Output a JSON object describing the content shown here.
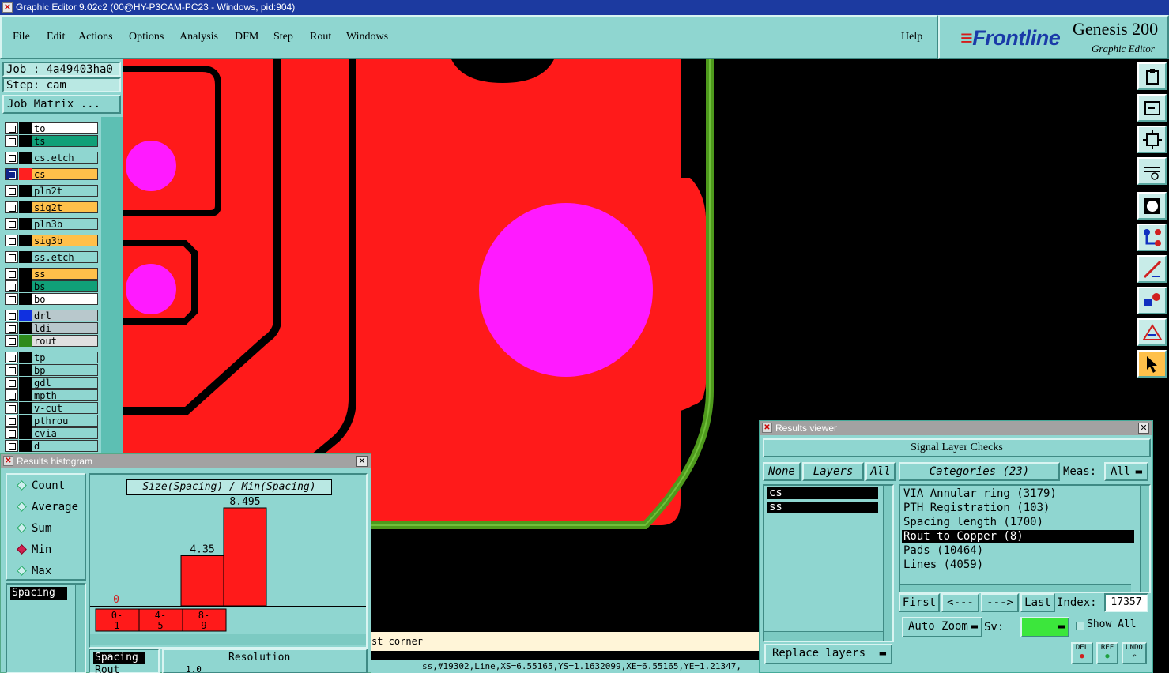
{
  "window": {
    "title": "Graphic Editor 9.02c2 (00@HY-P3CAM-PC23 - Windows, pid:904)"
  },
  "menu": [
    "File",
    "Edit",
    "Actions",
    "Options",
    "Analysis",
    "DFM",
    "Step",
    "Rout",
    "Windows"
  ],
  "help": "Help",
  "brand": {
    "logo": "Frontline",
    "product": "Genesis 200",
    "subtitle": "Graphic Editor"
  },
  "job": {
    "job_label": "Job : 4a49403ha0",
    "step_label": "Step: cam",
    "matrix_button": "Job Matrix ..."
  },
  "colors": {
    "copper": "#ff1a1a",
    "pad": "#ff1aff",
    "rout": "#4e9a1c",
    "ui": "#8fd6d0",
    "orange_layer": "#ffc04a",
    "green_layer": "#10a078"
  },
  "layers": [
    {
      "name": "to",
      "chip": "#000000",
      "bg": "#ffffff"
    },
    {
      "name": "ts",
      "chip": "#000000",
      "bg": "#10a078"
    },
    {
      "name": "cs.etch",
      "chip": "#000000",
      "bg": "#8fd6d0"
    },
    {
      "name": "cs",
      "chip": "#ff2020",
      "bg": "#ffc04a",
      "selected": true
    },
    {
      "name": "pln2t",
      "chip": "#000000",
      "bg": "#8fd6d0"
    },
    {
      "name": "sig2t",
      "chip": "#000000",
      "bg": "#ffc04a"
    },
    {
      "name": "pln3b",
      "chip": "#000000",
      "bg": "#8fd6d0"
    },
    {
      "name": "sig3b",
      "chip": "#000000",
      "bg": "#ffc04a"
    },
    {
      "name": "ss.etch",
      "chip": "#000000",
      "bg": "#8fd6d0"
    },
    {
      "name": "ss",
      "chip": "#000000",
      "bg": "#ffc04a"
    },
    {
      "name": "bs",
      "chip": "#000000",
      "bg": "#10a078"
    },
    {
      "name": "bo",
      "chip": "#000000",
      "bg": "#ffffff"
    },
    {
      "name": "drl",
      "chip": "#1030e0",
      "bg": "#b8c8cc"
    },
    {
      "name": "ldi",
      "chip": "#000000",
      "bg": "#b8c8cc"
    },
    {
      "name": "rout",
      "chip": "#2e8a1c",
      "bg": "#e0e0e0"
    },
    {
      "name": "tp",
      "chip": "#000000",
      "bg": "#8fd6d0"
    },
    {
      "name": "bp",
      "chip": "#000000",
      "bg": "#8fd6d0"
    },
    {
      "name": "gdl",
      "chip": "#000000",
      "bg": "#8fd6d0"
    },
    {
      "name": "mpth",
      "chip": "#000000",
      "bg": "#8fd6d0"
    },
    {
      "name": "v-cut",
      "chip": "#000000",
      "bg": "#8fd6d0"
    },
    {
      "name": "pthrou",
      "chip": "#000000",
      "bg": "#8fd6d0"
    },
    {
      "name": "cvia",
      "chip": "#000000",
      "bg": "#8fd6d0"
    },
    {
      "name": "d",
      "chip": "#000000",
      "bg": "#8fd6d0"
    }
  ],
  "toolbar_icons": [
    "clipboard-icon",
    "exit-icon",
    "fit-screen-icon",
    "measure-icon",
    "snap-icon",
    "nodes-icon",
    "line-edit-icon",
    "select-icon",
    "warning-icon",
    "pointer-icon"
  ],
  "histogram": {
    "title": "Results histogram",
    "modes": [
      {
        "label": "Count",
        "on": false
      },
      {
        "label": "Average",
        "on": false
      },
      {
        "label": "Sum",
        "on": false
      },
      {
        "label": "Min",
        "on": true
      },
      {
        "label": "Max",
        "on": false
      }
    ],
    "list_item": "Spacing",
    "chart_title": "Size(Spacing) / Min(Spacing)",
    "resolution_label": "Resolution",
    "list_item2": "Spacing",
    "list_item3": "Rout",
    "resolution_value": "1.0"
  },
  "chart_data": {
    "type": "bar",
    "title": "Size(Spacing) / Min(Spacing)",
    "categories": [
      "0-\n1",
      "4-\n5",
      "8-\n9"
    ],
    "bin_labels_top": [
      "0-",
      "4-",
      "8-"
    ],
    "bin_labels_bottom": [
      "1",
      "5",
      "9"
    ],
    "values": [
      0,
      4.35,
      8.495
    ],
    "value_labels": [
      "0",
      "4.35",
      "8.495"
    ],
    "ylim": [
      0,
      8.495
    ],
    "color": "#ff1a1a"
  },
  "viewer": {
    "title": "Results viewer",
    "header": "Signal Layer Checks",
    "none": "None",
    "layers_btn": "Layers",
    "all_btn": "All",
    "categories_btn": "Categories (23)",
    "meas_label": "Meas:",
    "meas_value": "All",
    "layer_list": [
      "cs",
      "ss"
    ],
    "categories": [
      {
        "label": "VIA Annular ring (3179)",
        "selected": false
      },
      {
        "label": "PTH Registration (103)",
        "selected": false
      },
      {
        "label": "Spacing length (1700)",
        "selected": false
      },
      {
        "label": "Rout to Copper (8)",
        "selected": true
      },
      {
        "label": "Pads (10464)",
        "selected": false
      },
      {
        "label": "Lines (4059)",
        "selected": false
      }
    ],
    "first": "First",
    "prev": "<---",
    "next": "--->",
    "last": "Last",
    "index_label": "Index:",
    "index_value": "17357",
    "auto_zoom": "Auto Zoom",
    "sv_label": "Sv:",
    "show_all": "Show All",
    "replace_layers": "Replace layers",
    "del": "DEL",
    "ref": "REF",
    "undo": "UNDO"
  },
  "status": {
    "message": "st corner",
    "coords": "ss,#19302,Line,XS=6.55165,YS=1.1632099,XE=6.55165,YE=1.21347,"
  }
}
